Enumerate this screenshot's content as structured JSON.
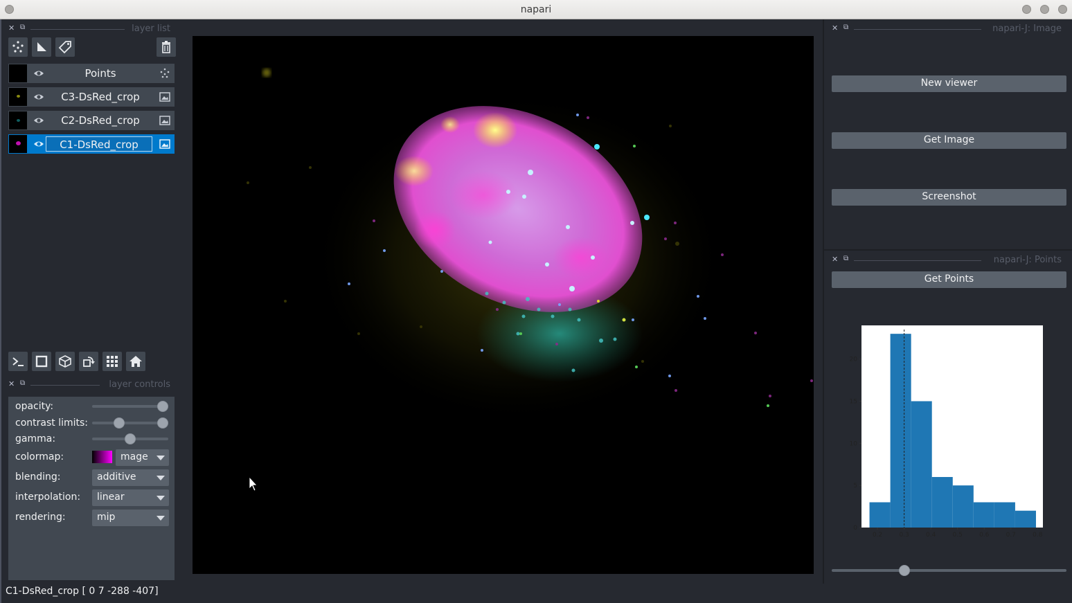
{
  "window": {
    "title": "napari"
  },
  "layer_list": {
    "title": "layer list",
    "layers": [
      {
        "name": "Points",
        "type": "points",
        "selected": false
      },
      {
        "name": "C3-DsRed_crop",
        "type": "image",
        "selected": false
      },
      {
        "name": "C2-DsRed_crop",
        "type": "image",
        "selected": false
      },
      {
        "name": "C1-DsRed_crop",
        "type": "image",
        "selected": true
      }
    ]
  },
  "layer_controls": {
    "title": "layer controls",
    "opacity": {
      "label": "opacity:",
      "value": 1.0
    },
    "contrast_limits": {
      "label": "contrast limits:",
      "low": 0.33,
      "high": 1.0
    },
    "gamma": {
      "label": "gamma:",
      "value": 0.5
    },
    "colormap": {
      "label": "colormap:",
      "value": "mage",
      "color": "#ff00ff"
    },
    "blending": {
      "label": "blending:",
      "value": "additive"
    },
    "interpolation": {
      "label": "interpolation:",
      "value": "linear"
    },
    "rendering": {
      "label": "rendering:",
      "value": "mip"
    }
  },
  "image_panel": {
    "title": "napari-J: Image",
    "new_viewer": "New viewer",
    "get_image": "Get Image",
    "screenshot": "Screenshot"
  },
  "points_panel": {
    "title": "napari-J: Points",
    "get_points": "Get Points",
    "slider_value": 0.3
  },
  "status_bar": {
    "text": "C1-DsRed_crop [   0    7 -288 -407]"
  },
  "chart_data": {
    "type": "bar",
    "title": "",
    "xlabel": "",
    "ylabel": "",
    "x_ticks": [
      "0.2",
      "0.3",
      "0.4",
      "0.5",
      "0.6",
      "0.7",
      "0.8"
    ],
    "y_ticks": [
      "0",
      "5",
      "10",
      "15",
      "20"
    ],
    "xlim": [
      0.14,
      0.82
    ],
    "ylim": [
      0,
      24
    ],
    "bin_edges": [
      0.17,
      0.248,
      0.326,
      0.404,
      0.482,
      0.56,
      0.638,
      0.716,
      0.794
    ],
    "values": [
      3,
      23,
      15,
      6,
      5,
      3,
      3,
      2
    ],
    "threshold": 0.3,
    "color": "#1f77b4"
  }
}
